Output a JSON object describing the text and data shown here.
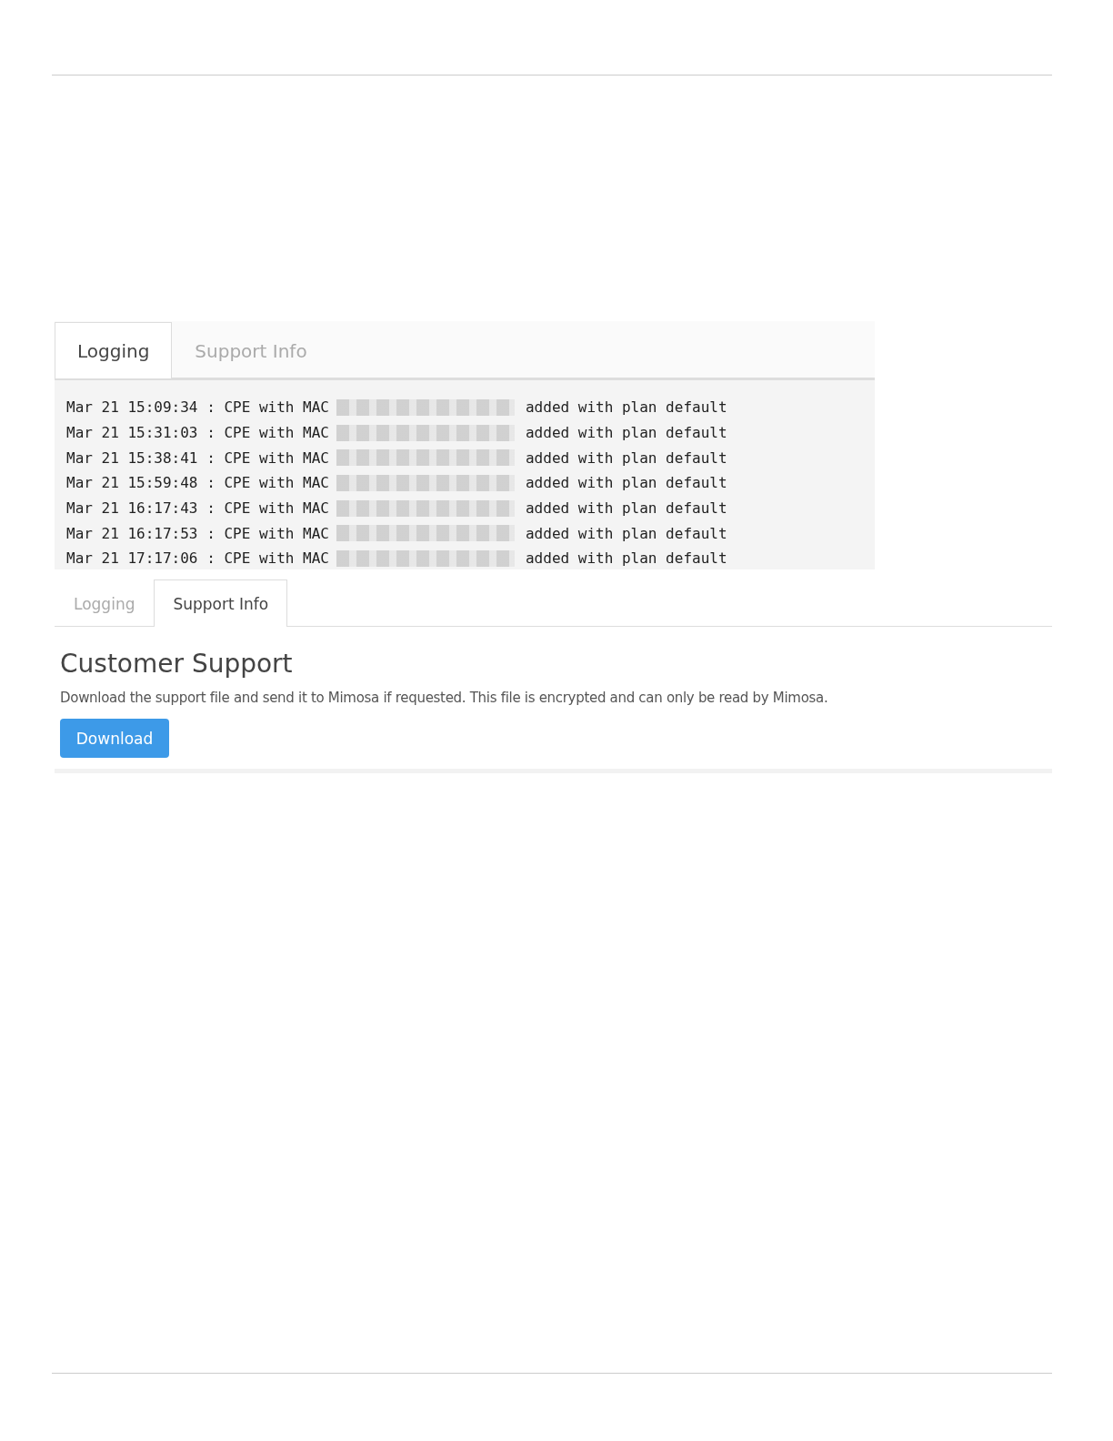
{
  "logging_screenshot": {
    "tabs": [
      {
        "label": "Logging",
        "selected": true
      },
      {
        "label": "Support Info",
        "selected": false
      }
    ],
    "log_lines": [
      {
        "prefix": "Mar 21 15:09:34 : CPE with MAC",
        "suffix": "added with plan default"
      },
      {
        "prefix": "Mar 21 15:31:03 : CPE with MAC",
        "suffix": "added with plan default"
      },
      {
        "prefix": "Mar 21 15:38:41 : CPE with MAC",
        "suffix": "added with plan default"
      },
      {
        "prefix": "Mar 21 15:59:48 : CPE with MAC",
        "suffix": "added with plan default"
      },
      {
        "prefix": "Mar 21 16:17:43 : CPE with MAC",
        "suffix": "added with plan default"
      },
      {
        "prefix": "Mar 21 16:17:53 : CPE with MAC",
        "suffix": "added with plan default"
      },
      {
        "prefix": "Mar 21 17:17:06 : CPE with MAC",
        "suffix": "added with plan default"
      }
    ]
  },
  "support_screenshot": {
    "tabs": [
      {
        "label": "Logging",
        "selected": false
      },
      {
        "label": "Support Info",
        "selected": true
      }
    ],
    "heading": "Customer Support",
    "description": "Download the support file and send it to Mimosa if requested. This file is encrypted and can only be read by Mimosa.",
    "button": "Download"
  }
}
